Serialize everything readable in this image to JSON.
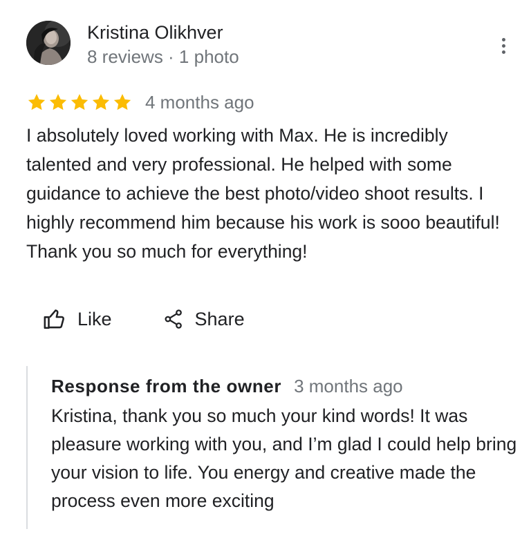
{
  "review": {
    "author": {
      "name": "Kristina Olikhver",
      "meta": "8 reviews · 1 photo",
      "avatar_icon": "profile-photo"
    },
    "more_icon": "more-vert-icon",
    "rating": {
      "stars": 5,
      "max": 5,
      "star_color": "#fbbc04",
      "date": "4 months ago"
    },
    "text": "I absolutely loved working with Max. He is incredibly talented and very professional. He helped with some guidance to achieve the best photo/video shoot results. I highly recommend him because his work is sooo beautiful! Thank you so much for everything!",
    "actions": {
      "like_label": "Like",
      "like_icon": "thumbs-up-icon",
      "share_label": "Share",
      "share_icon": "share-icon"
    },
    "owner_response": {
      "title": "Response from the owner",
      "date": "3 months ago",
      "text": "Kristina, thank you so much your kind words! It was pleasure working with you, and I’m glad I could help bring your vision to life.  You energy and creative made the process even more exciting"
    }
  },
  "colors": {
    "primary_text": "#202124",
    "secondary_text": "#70757a",
    "star": "#fbbc04",
    "divider": "#dadce0"
  }
}
